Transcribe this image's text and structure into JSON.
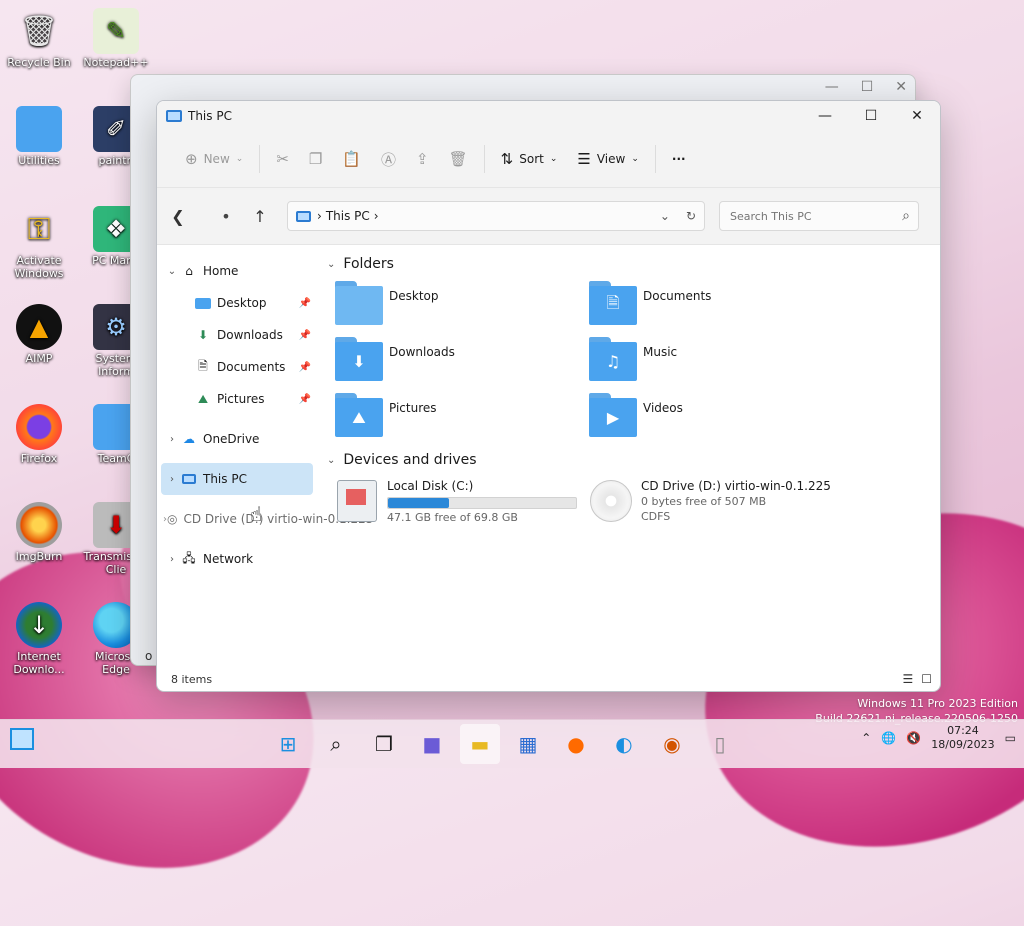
{
  "desktop": {
    "icons": [
      {
        "label": "Recycle Bin"
      },
      {
        "label": "Notepad++"
      },
      {
        "label": "Utilities"
      },
      {
        "label": "paintn"
      },
      {
        "label": "Activate Windows"
      },
      {
        "label": "PC Mana"
      },
      {
        "label": "AIMP"
      },
      {
        "label": "System Inform"
      },
      {
        "label": "Firefox"
      },
      {
        "label": "TeamC"
      },
      {
        "label": "ImgBurn"
      },
      {
        "label": "Transmis Qt Clie"
      },
      {
        "label": "Internet Downlo..."
      },
      {
        "label": "Microso Edge"
      }
    ],
    "watermark": {
      "line1": "Windows 11 Pro 2023 Edition",
      "line2": "Build 22621.ni_release.220506-1250"
    }
  },
  "bg_window": {
    "partial_text": "o i"
  },
  "window": {
    "title": "This PC",
    "toolbar": {
      "new": "New",
      "sort": "Sort",
      "view": "View",
      "more": "···"
    },
    "address": {
      "crumb": "This PC"
    },
    "search": {
      "placeholder": "Search This PC"
    },
    "nav": {
      "home": "Home",
      "desktop": "Desktop",
      "downloads": "Downloads",
      "documents": "Documents",
      "pictures": "Pictures",
      "onedrive": "OneDrive",
      "this_pc": "This PC",
      "cd_drive": "CD Drive (D:) virtio-win-0.1.225",
      "network": "Network"
    },
    "folders_header": "Folders",
    "folders": [
      {
        "name": "Desktop"
      },
      {
        "name": "Documents"
      },
      {
        "name": "Downloads"
      },
      {
        "name": "Music"
      },
      {
        "name": "Pictures"
      },
      {
        "name": "Videos"
      }
    ],
    "drives_header": "Devices and drives",
    "drives": [
      {
        "name": "Local Disk (C:)",
        "free": "47.1 GB free of 69.8 GB",
        "used_fraction": 0.325
      },
      {
        "name": "CD Drive (D:) virtio-win-0.1.225",
        "free": "0 bytes free of 507 MB",
        "fs": "CDFS"
      }
    ],
    "status": {
      "items": "8 items"
    }
  },
  "taskbar": {
    "clock_time": "07:24",
    "clock_date": "18/09/2023"
  },
  "colors": {
    "accent": "#2b88d8",
    "selected": "#cce4f7",
    "folder": "#4aa3ef"
  }
}
